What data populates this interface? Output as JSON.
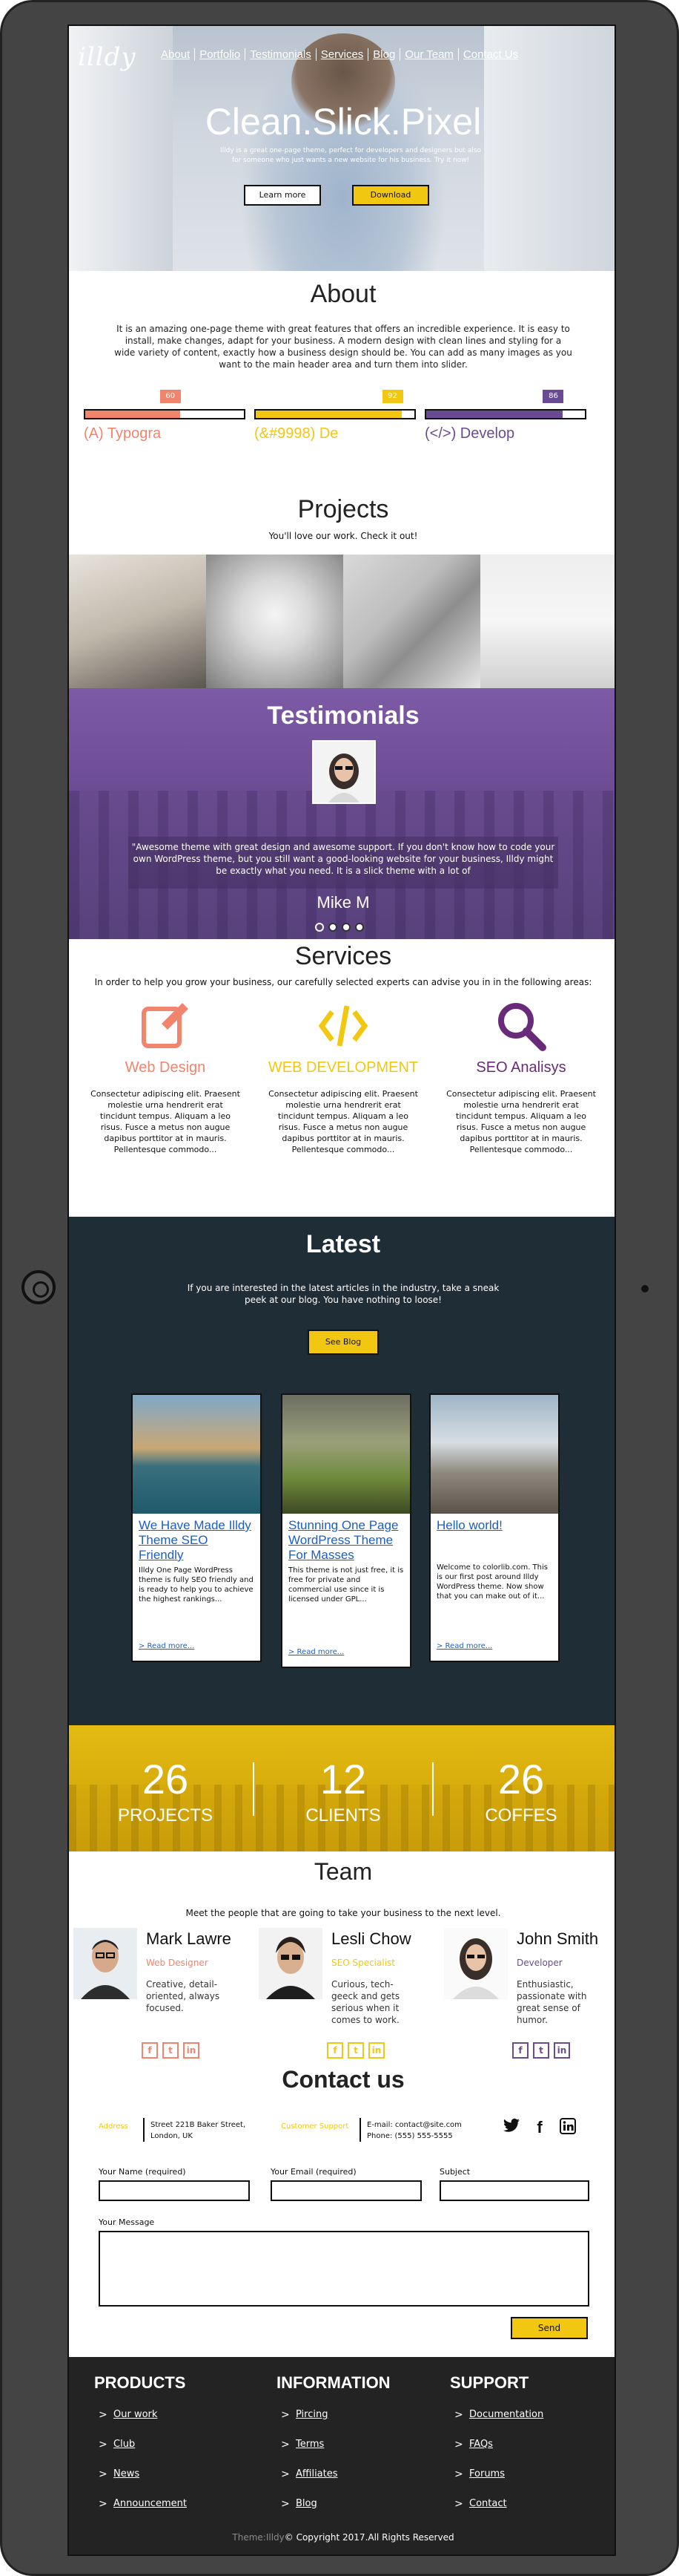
{
  "header": {
    "logo": "illdy",
    "nav": [
      "About",
      "Portfolio",
      "Testimonials",
      "Services",
      "Blog",
      "Our Team",
      "Contact Us"
    ],
    "title": "Clean.Slick.Pixel",
    "subtitle": "Illdy is a great one-page theme, perfect for developers and designers but also for someone who just wants a new website for his business. Try it now!",
    "btn_learn": "Learn more",
    "btn_download": "Download"
  },
  "about": {
    "title": "About",
    "text": "It is an amazing one-page theme with great features that offers an incredible experience. It is easy to install, make changes, adapt for your business. A modern design with clean lines and styling for a wide variety of content, exactly how a business design should be. You can add as many images as you want to the main header area and turn them into slider.",
    "skills": [
      {
        "label": "(A) Typogra",
        "value": 60,
        "color": "#f1846c"
      },
      {
        "label": "(&#9998) De",
        "value": 92,
        "color": "#f2c711"
      },
      {
        "label": "(</>) Develop",
        "value": 86,
        "color": "#6a4b92"
      }
    ]
  },
  "projects": {
    "title": "Projects",
    "subtitle": "You'll love our work. Check it out!"
  },
  "testimonials": {
    "title": "Testimonials",
    "quote": "\"Awesome theme with great design and awesome support. If you don't know how to code your own WordPress theme, but you still want a good-looking website for your business, Illdy might be exactly what you need. It is a slick theme with a lot of",
    "author": "Mike M"
  },
  "services": {
    "title": "Services",
    "intro": "In order to help you grow your business, our carefully selected experts can advise you in in the following areas:",
    "items": [
      {
        "name": "Web Design",
        "color": "#f1846c",
        "icon": "pencil-icon",
        "desc": "Consectetur adipiscing elit. Praesent molestie urna hendrerit erat tincidunt tempus. Aliquam a leo risus. Fusce a metus non augue dapibus porttitor at in mauris. Pellentesque commodo..."
      },
      {
        "name": "WEB DEVELOPMENT",
        "color": "#f2c711",
        "icon": "code-icon",
        "desc": "Consectetur adipiscing elit. Praesent molestie urna hendrerit erat tincidunt tempus. Aliquam a leo risus. Fusce a metus non augue dapibus porttitor at in mauris. Pellentesque commodo..."
      },
      {
        "name": "SEO Analisys",
        "color": "#6a2a7a",
        "icon": "magnifier-icon",
        "desc": "Consectetur adipiscing elit. Praesent molestie urna hendrerit erat tincidunt tempus. Aliquam a leo risus. Fusce a metus non augue dapibus porttitor at in mauris. Pellentesque commodo..."
      }
    ]
  },
  "latest": {
    "title": "Latest",
    "intro": "If you are interested in the latest articles in the industry, take a sneak peek at our blog. You have nothing to loose!",
    "see_blog": "See Blog",
    "posts": [
      {
        "title": "We Have Made Illdy Theme SEO Friendly",
        "text": "Illdy One Page WordPress theme is fully SEO friendly and is ready to help you to achieve the highest rankings...",
        "more": "> Read more..."
      },
      {
        "title": "Stunning One Page WordPress Theme For Masses",
        "text": "This theme is not just free, it is free for private and commercial use since it is licensed under GPL...",
        "more": "> Read more..."
      },
      {
        "title": "Hello world!",
        "text": "Welcome to colorlib.com. This is our first post around Illdy WordPress theme. Now show that you can make out of it...",
        "more": "> Read more..."
      }
    ]
  },
  "stats": [
    {
      "num": "26",
      "label": "PROJECTS"
    },
    {
      "num": "12",
      "label": "CLIENTS"
    },
    {
      "num": "26",
      "label": "COFFES"
    }
  ],
  "team": {
    "title": "Team",
    "intro": "Meet the people that are going to take your business to the next level.",
    "members": [
      {
        "name": "Mark Lawre",
        "role": "Web Designer",
        "role_color": "#f1846c",
        "bio": "Creative, detail-oriented, always focused.",
        "social_color": "#f1846c"
      },
      {
        "name": "Lesli Chow",
        "role": "SEO Specialist",
        "role_color": "#f2c711",
        "bio": "Curious, tech-geeck and gets serious when it comes to work.",
        "social_color": "#f2c711"
      },
      {
        "name": "John Smith",
        "role": "Developer",
        "role_color": "#6a4b92",
        "bio": "Enthusiastic, passionate with great sense of humor.",
        "social_color": "#6a4b92"
      }
    ]
  },
  "contact": {
    "title": "Contact us",
    "address_label": "Address",
    "address": "Street 221B Baker Street, London, UK",
    "support_label": "Customer Support",
    "email": "E-mail: contact@site.com",
    "phone": "Phone: (555) 555-5555",
    "field_name": "Your Name (required)",
    "field_email": "Your Email (required)",
    "field_subject": "Subject",
    "field_message": "Your Message",
    "send": "Send"
  },
  "footer": {
    "products": {
      "title": "PRODUCTS",
      "items": [
        "Our work",
        "Club",
        "News",
        "Announcement"
      ]
    },
    "information": {
      "title": "INFORMATION",
      "items": [
        "Pircing",
        "Terms",
        "Affiliates",
        "Blog"
      ]
    },
    "support": {
      "title": "SUPPORT",
      "items": [
        "Documentation",
        "FAQs",
        "Forums",
        "Contact"
      ]
    },
    "brand": "Theme:Illdy",
    "copyright": "© Copyright 2017.All Rights Reserved"
  }
}
